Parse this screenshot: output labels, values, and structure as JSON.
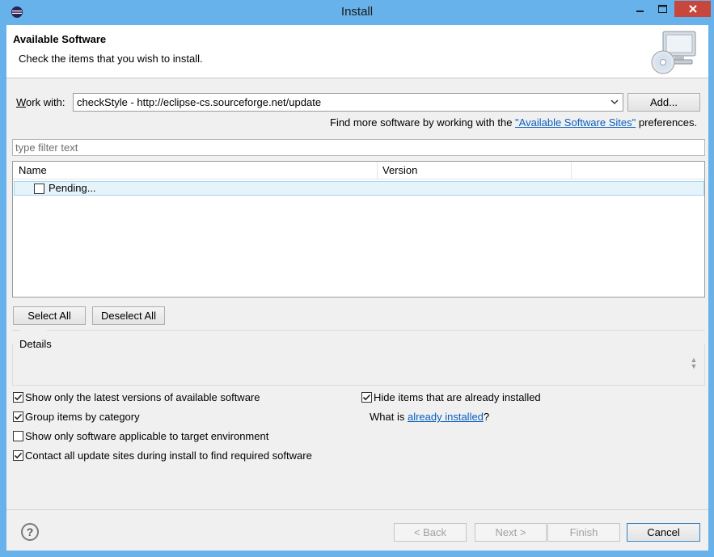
{
  "window": {
    "title": "Install"
  },
  "banner": {
    "title": "Available Software",
    "description": "Check the items that you wish to install."
  },
  "work_with": {
    "label": "Work with:",
    "value": "checkStyle - http://eclipse-cs.sourceforge.net/update",
    "add_button": "Add...",
    "find_more_prefix": "Find more software by working with the ",
    "find_more_link": "\"Available Software Sites\"",
    "find_more_suffix": " preferences."
  },
  "filter": {
    "placeholder": "type filter text"
  },
  "table": {
    "columns": [
      "Name",
      "Version"
    ],
    "rows": [
      {
        "name": "Pending...",
        "checked": false
      }
    ]
  },
  "selection_buttons": {
    "select_all": "Select All",
    "deselect_all": "Deselect All"
  },
  "details": {
    "label": "Details"
  },
  "options": {
    "show_latest": {
      "label": "Show only the latest versions of available software",
      "checked": true
    },
    "group_by_category": {
      "label": "Group items by category",
      "checked": true
    },
    "applicable_only": {
      "label": "Show only software applicable to target environment",
      "checked": false
    },
    "contact_all_sites": {
      "label": "Contact all update sites during install to find required software",
      "checked": true
    },
    "hide_installed": {
      "label": "Hide items that are already installed",
      "checked": true
    },
    "what_is_prefix": "What is ",
    "what_is_link": "already installed",
    "what_is_suffix": "?"
  },
  "footer": {
    "back": "< Back",
    "next": "Next >",
    "finish": "Finish",
    "cancel": "Cancel"
  },
  "colors": {
    "titlebar": "#67b2ea",
    "close_button": "#c7473d",
    "link": "#0a5ec0",
    "selection": "#e5f3fb"
  }
}
